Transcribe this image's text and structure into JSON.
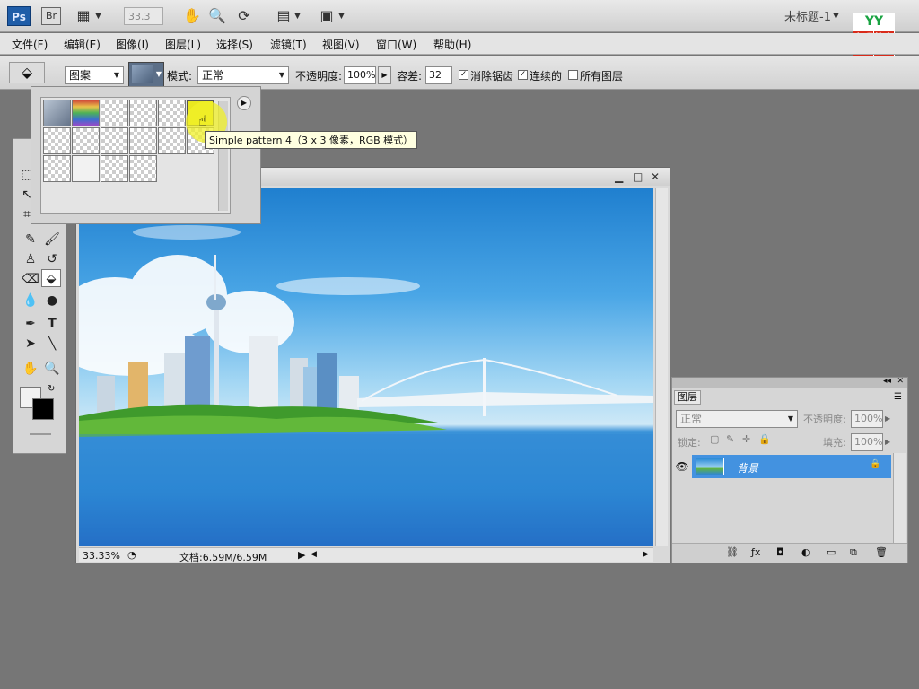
{
  "app": {
    "logo_text": "Ps",
    "bridge_text": "Br",
    "zoom_combo": "33.3",
    "window_title": "未标题-1"
  },
  "watermark": {
    "top_text": "YY",
    "left_text": "育碟",
    "right_text": "教育"
  },
  "menu": [
    "文件(F)",
    "编辑(E)",
    "图像(I)",
    "图层(L)",
    "选择(S)",
    "滤镜(T)",
    "视图(V)",
    "窗口(W)",
    "帮助(H)"
  ],
  "options": {
    "fill_source": "图案",
    "mode_label": "模式:",
    "mode_value": "正常",
    "opacity_label": "不透明度:",
    "opacity_value": "100%",
    "tolerance_label": "容差:",
    "tolerance_value": "32",
    "antialias_label": "消除锯齿",
    "contiguous_label": "连续的",
    "all_layers_label": "所有图层"
  },
  "tooltip": "Simple pattern 4（3 x 3 像素，RGB 模式）",
  "doc": {
    "zoom": "33.33%",
    "doc_size": "文档:6.59M/6.59M"
  },
  "layers": {
    "tab": "图层",
    "blend_mode": "正常",
    "opacity_label": "不透明度:",
    "opacity_value": "100%",
    "lock_label": "锁定:",
    "fill_label": "填充:",
    "fill_value": "100%",
    "layer_name": "背景"
  },
  "colors": {
    "accent": "#4392e0",
    "sky": "#1f7fcf",
    "tooltip_bg": "#ffffe0",
    "ps_blue": "#1f5da8"
  }
}
